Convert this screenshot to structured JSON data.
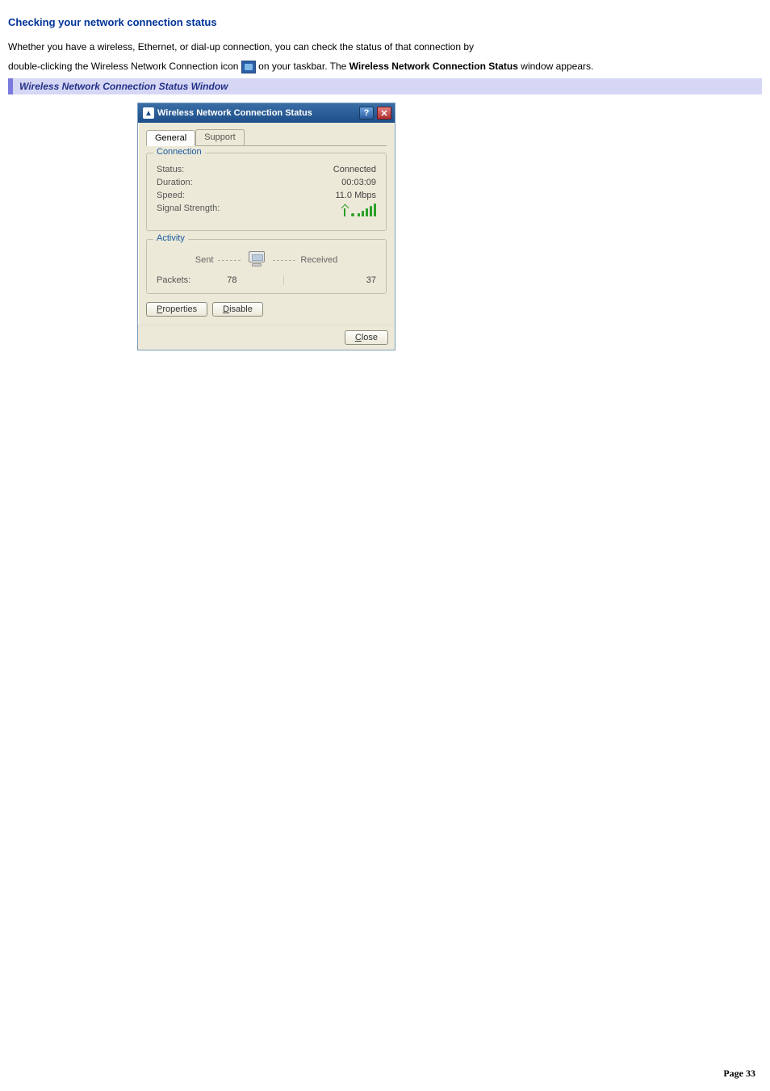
{
  "heading": "Checking your network connection status",
  "para1_a": "Whether you have a wireless, Ethernet, or dial-up connection, you can check the status of that connection by",
  "para2_a": "double-clicking the Wireless Network Connection icon ",
  "para2_b": " on your taskbar. The ",
  "para2_bold": "Wireless Network Connection Status",
  "para2_c": " window appears.",
  "caption": "Wireless Network Connection Status Window",
  "dialog": {
    "title": "Wireless Network Connection Status",
    "help_glyph": "?",
    "close_glyph": "✕",
    "tabs": {
      "general": "General",
      "support": "Support"
    },
    "connection": {
      "legend": "Connection",
      "status_label": "Status:",
      "status_value": "Connected",
      "duration_label": "Duration:",
      "duration_value": "00:03:09",
      "speed_label": "Speed:",
      "speed_value": "11.0 Mbps",
      "signal_label": "Signal Strength:"
    },
    "activity": {
      "legend": "Activity",
      "sent": "Sent",
      "received": "Received",
      "packets_label": "Packets:",
      "packets_sent": "78",
      "packets_received": "37"
    },
    "buttons": {
      "properties_u": "P",
      "properties_rest": "roperties",
      "disable_u": "D",
      "disable_rest": "isable",
      "close_u": "C",
      "close_rest": "lose"
    }
  },
  "footer": {
    "label": "Page ",
    "number": "33"
  }
}
